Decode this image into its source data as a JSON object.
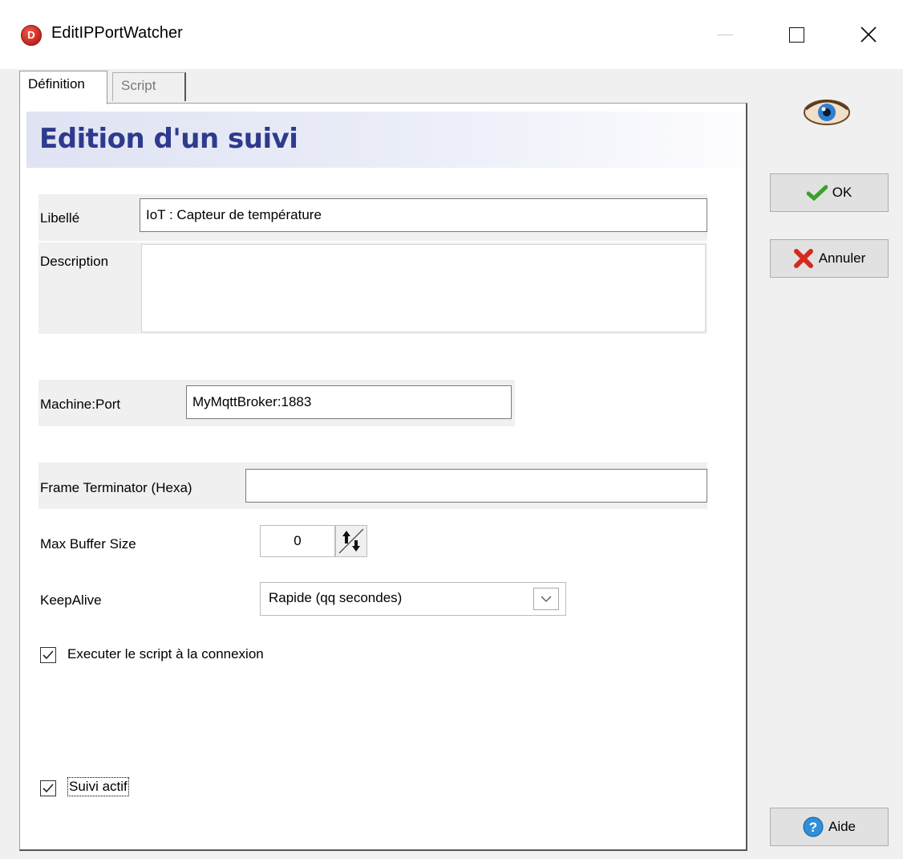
{
  "window": {
    "title": "EditIPPortWatcher",
    "icon_letter": "D",
    "icon": "app-logo-icon",
    "controls": [
      "minimize-icon",
      "maximize-icon",
      "close-icon"
    ]
  },
  "tabs": [
    {
      "label": "Définition",
      "active": true
    },
    {
      "label": "Script",
      "active": false
    }
  ],
  "header": {
    "title": "Edition d'un suivi"
  },
  "form": {
    "libelle": {
      "label": "Libellé",
      "value": "IoT : Capteur de température"
    },
    "description": {
      "label": "Description",
      "value": ""
    },
    "machine_port": {
      "label": "Machine:Port",
      "value": "MyMqttBroker:1883"
    },
    "frame_terminator": {
      "label": "Frame Terminator (Hexa)",
      "value": ""
    },
    "max_buffer": {
      "label": "Max Buffer Size",
      "value": "0"
    },
    "keepalive": {
      "label": "KeepAlive",
      "value": "Rapide (qq secondes)"
    },
    "exec_script": {
      "label": "Executer le script à la connexion",
      "checked": true
    },
    "suivi_actif": {
      "label": "Suivi actif",
      "checked": true
    }
  },
  "buttons": {
    "ok": "OK",
    "cancel": "Annuler",
    "help": "Aide"
  },
  "icons": {
    "eye": "eye-icon",
    "ok": "checkmark-icon",
    "cancel": "red-x-icon",
    "help": "help-icon"
  },
  "colors": {
    "header_title": "#2e3a8c",
    "header_bg": "#dfe3f3",
    "ok_check": "#3aa02a",
    "cancel_x": "#d42a1e",
    "help": "#2f8fd8"
  }
}
